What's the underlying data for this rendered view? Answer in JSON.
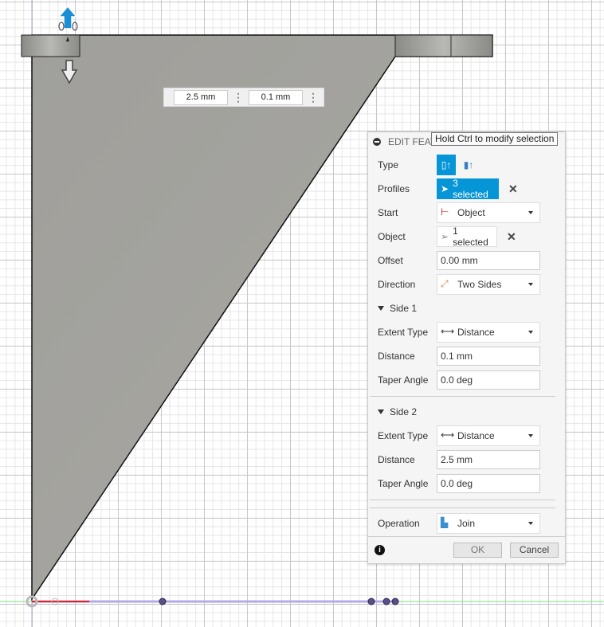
{
  "canvas": {
    "dimension_inputs": [
      "2.5 mm",
      "0.1 mm"
    ]
  },
  "tooltip": "Hold Ctrl to modify selection",
  "dialog": {
    "title": "EDIT FEAT",
    "type_label": "Type",
    "profiles": {
      "label": "Profiles",
      "value": "3 selected"
    },
    "start": {
      "label": "Start",
      "value": "Object"
    },
    "object": {
      "label": "Object",
      "value": "1 selected"
    },
    "offset": {
      "label": "Offset",
      "value": "0.00 mm"
    },
    "direction": {
      "label": "Direction",
      "value": "Two Sides"
    },
    "side1": {
      "title": "Side 1",
      "extent_label": "Extent Type",
      "extent": "Distance",
      "distance_label": "Distance",
      "distance": "0.1 mm",
      "taper_label": "Taper Angle",
      "taper": "0.0 deg"
    },
    "side2": {
      "title": "Side 2",
      "extent_label": "Extent Type",
      "extent": "Distance",
      "distance_label": "Distance",
      "distance": "2.5 mm",
      "taper_label": "Taper Angle",
      "taper": "0.0 deg"
    },
    "operation": {
      "label": "Operation",
      "value": "Join"
    },
    "ok": "OK",
    "cancel": "Cancel"
  },
  "colors": {
    "accent": "#0696d7",
    "body": "#a3a39e",
    "axis_x": "#b4a8e8",
    "axis_red": "#d22"
  }
}
